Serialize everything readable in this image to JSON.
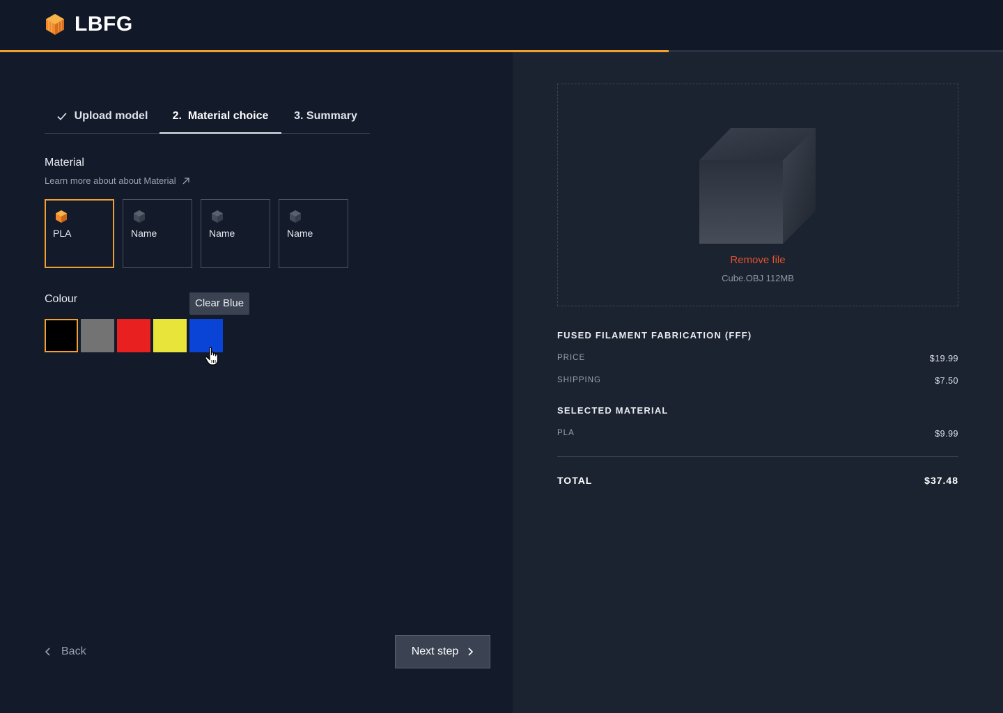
{
  "brand": {
    "name": "LBFG",
    "accent": "#f2a030"
  },
  "progress": {
    "percent": 66.7
  },
  "steps": [
    {
      "label": "Upload model",
      "status": "done",
      "icon": "check-icon"
    },
    {
      "label": "2.  Material choice",
      "status": "active"
    },
    {
      "label": "3. Summary",
      "status": "pending"
    }
  ],
  "material": {
    "label": "Material",
    "learn_more": "Learn more about about Material",
    "options": [
      {
        "name": "PLA",
        "icon": "cube-icon",
        "selected": true
      },
      {
        "name": "Name",
        "icon": "cube-icon",
        "selected": false
      },
      {
        "name": "Name",
        "icon": "cube-icon",
        "selected": false
      },
      {
        "name": "Name",
        "icon": "cube-icon",
        "selected": false
      }
    ]
  },
  "colour": {
    "label": "Colour",
    "tooltip": "Clear Blue",
    "swatches": [
      {
        "color": "#000000",
        "selected": true
      },
      {
        "color": "#737373",
        "selected": false
      },
      {
        "color": "#e8201f",
        "selected": false
      },
      {
        "color": "#e9e43a",
        "selected": false
      },
      {
        "color": "#0a44d6",
        "selected": false,
        "hovered": true
      }
    ]
  },
  "nav": {
    "back": "Back",
    "next": "Next step"
  },
  "file": {
    "remove": "Remove file",
    "info": "Cube.OBJ 112MB"
  },
  "summary": {
    "fff_heading": "FUSED FILAMENT FABRICATION (FFF)",
    "price_label": "PRICE",
    "price_value": "$19.99",
    "shipping_label": "SHIPPING",
    "shipping_value": "$7.50",
    "material_heading": "SELECTED MATERIAL",
    "material_label": "PLA",
    "material_value": "$9.99",
    "total_label": "TOTAL",
    "total_value": "$37.48"
  }
}
